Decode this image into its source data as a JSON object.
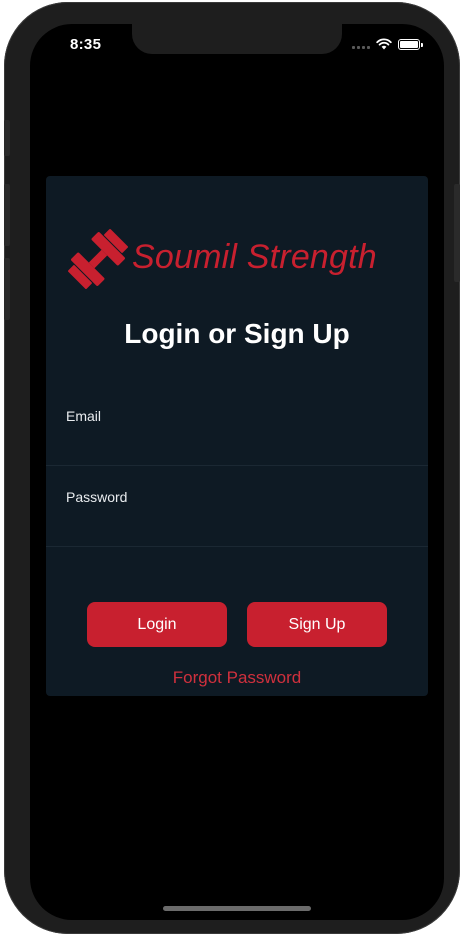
{
  "status_bar": {
    "time": "8:35",
    "signal_icon": "cellular-signal-icon",
    "wifi_icon": "wifi-icon",
    "battery_icon": "battery-icon",
    "battery_level": 1.0
  },
  "brand": {
    "name": "Soumil Strength",
    "logo_icon": "dumbbell-icon",
    "color": "#c8202f"
  },
  "login": {
    "title": "Login or Sign Up",
    "email_label": "Email",
    "email_value": "",
    "password_label": "Password",
    "password_value": "",
    "login_button": "Login",
    "signup_button": "Sign Up",
    "forgot_password": "Forgot Password"
  },
  "colors": {
    "background": "#000000",
    "card": "#0e1a24",
    "accent": "#c8202f"
  }
}
